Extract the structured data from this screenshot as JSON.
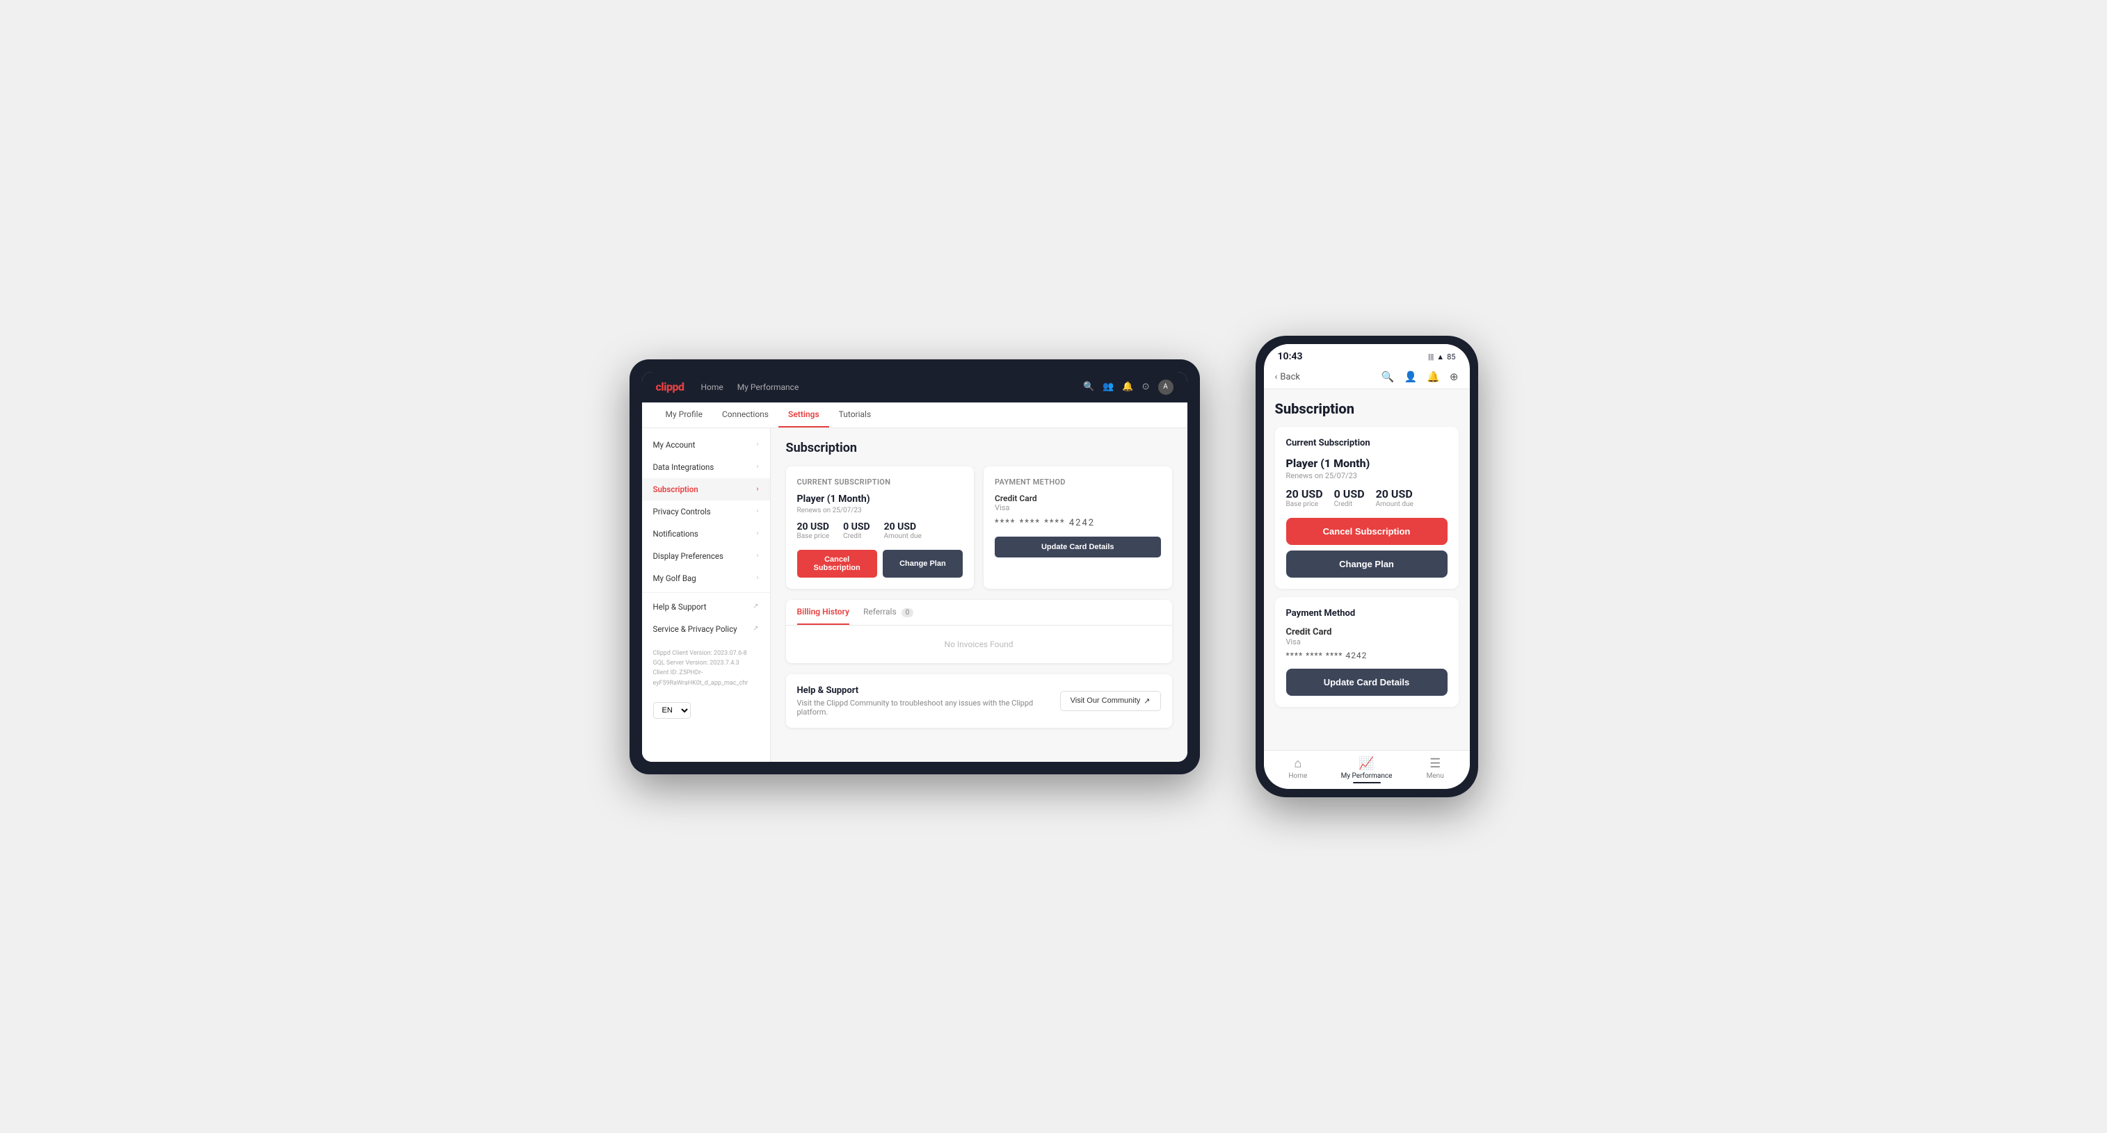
{
  "app": {
    "logo": "clippd",
    "nav": {
      "links": [
        "Home",
        "My Performance"
      ],
      "icons": [
        "search",
        "users",
        "bell",
        "circle",
        "user"
      ],
      "subnav": [
        "My Profile",
        "Connections",
        "Settings",
        "Tutorials"
      ]
    }
  },
  "tablet": {
    "sidebar": {
      "items": [
        {
          "label": "My Account",
          "active": false
        },
        {
          "label": "Data Integrations",
          "active": false
        },
        {
          "label": "Subscription",
          "active": true
        },
        {
          "label": "Privacy Controls",
          "active": false
        },
        {
          "label": "Notifications",
          "active": false
        },
        {
          "label": "Display Preferences",
          "active": false
        },
        {
          "label": "My Golf Bag",
          "active": false
        },
        {
          "label": "Help & Support",
          "active": false,
          "external": true
        },
        {
          "label": "Service & Privacy Policy",
          "active": false,
          "external": true
        }
      ],
      "footer": {
        "version": "Clippd Client Version: 2023.07.6-8",
        "server": "GQL Server Version: 2023.7.4.3",
        "client_id": "Client ID: Z5PHDr-eyF59RaWraHK0t_d_app_mac_chr"
      },
      "lang": "EN"
    },
    "main": {
      "page_title": "Subscription",
      "current_subscription": {
        "section_title": "Current Subscription",
        "plan_name": "Player (1 Month)",
        "renews": "Renews on 25/07/23",
        "base_price": "20 USD",
        "base_price_label": "Base price",
        "credit": "0 USD",
        "credit_label": "Credit",
        "amount_due": "20 USD",
        "amount_due_label": "Amount due",
        "cancel_btn": "Cancel Subscription",
        "change_btn": "Change Plan"
      },
      "payment_method": {
        "section_title": "Payment Method",
        "type": "Credit Card",
        "brand": "Visa",
        "card_number": "**** **** **** 4242",
        "update_btn": "Update Card Details"
      },
      "billing": {
        "tabs": [
          {
            "label": "Billing History",
            "active": true
          },
          {
            "label": "Referrals",
            "active": false,
            "badge": "0"
          }
        ],
        "empty_message": "No Invoices Found"
      },
      "help": {
        "title": "Help & Support",
        "description": "Visit the Clippd Community to troubleshoot any issues with the Clippd platform.",
        "community_btn": "Visit Our Community"
      }
    }
  },
  "phone": {
    "status_bar": {
      "time": "10:43",
      "signal": "|||",
      "wifi": "wifi",
      "battery": "85"
    },
    "nav": {
      "back": "Back",
      "icons": [
        "search",
        "user",
        "bell",
        "plus"
      ]
    },
    "page_title": "Subscription",
    "current_subscription": {
      "section_title": "Current Subscription",
      "plan_name": "Player (1 Month)",
      "renews": "Renews on 25/07/23",
      "base_price": "20 USD",
      "base_price_label": "Base price",
      "credit": "0 USD",
      "credit_label": "Credit",
      "amount_due": "20 USD",
      "amount_due_label": "Amount due",
      "cancel_btn": "Cancel Subscription",
      "change_btn": "Change Plan"
    },
    "payment_method": {
      "section_title": "Payment Method",
      "type": "Credit Card",
      "brand": "Visa",
      "card_number": "**** **** **** 4242",
      "update_btn": "Update Card Details"
    },
    "bottom_nav": [
      {
        "label": "Home",
        "icon": "⌂",
        "active": false
      },
      {
        "label": "My Performance",
        "icon": "📈",
        "active": true
      },
      {
        "label": "Menu",
        "icon": "☰",
        "active": false
      }
    ]
  }
}
